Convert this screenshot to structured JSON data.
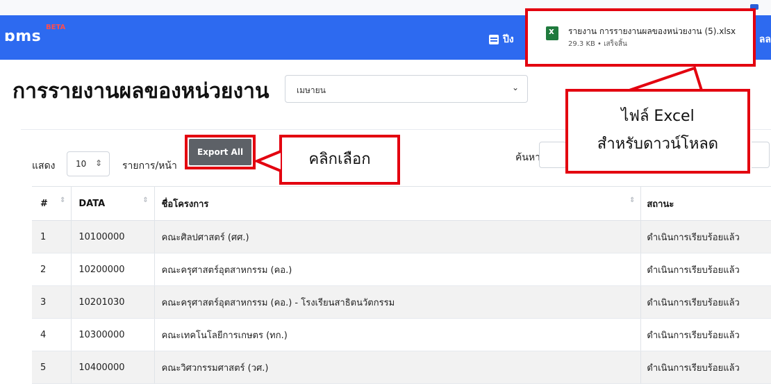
{
  "brand": {
    "name": "ɒms",
    "beta": "BETA"
  },
  "nav": {
    "calendar_label": "ปีง",
    "right_cut": "ลล"
  },
  "download": {
    "file_name": "รายงาน การรายงานผลของหน่วยงาน (5).xlsx",
    "meta": "29.3 KB • เสร็จสิ้น"
  },
  "page": {
    "title": "การรายงานผลของหน่วยงาน",
    "month": "เมษายน"
  },
  "callouts": {
    "excel_line1": "ไฟล์ Excel",
    "excel_line2": "สำหรับดาวน์โหลด",
    "click": "คลิกเลือก"
  },
  "controls": {
    "show_label": "แสดง",
    "entries_value": "10",
    "per_page_label": "รายการ/หน้า",
    "export_label": "Export All",
    "search_label": "ค้นหา :"
  },
  "table": {
    "headers": [
      "#",
      "DATA",
      "ชื่อโครงการ",
      "สถานะ"
    ],
    "rows": [
      {
        "num": "1",
        "data": "10100000",
        "name": "คณะศิลปศาสตร์ (ศศ.)",
        "status": "ดำเนินการเรียบร้อยแล้ว"
      },
      {
        "num": "2",
        "data": "10200000",
        "name": "คณะครุศาสตร์อุตสาหกรรม (คอ.)",
        "status": "ดำเนินการเรียบร้อยแล้ว"
      },
      {
        "num": "3",
        "data": "10201030",
        "name": "คณะครุศาสตร์อุตสาหกรรม (คอ.) - โรงเรียนสาธิตนวัตกรรม",
        "status": "ดำเนินการเรียบร้อยแล้ว"
      },
      {
        "num": "4",
        "data": "10300000",
        "name": "คณะเทคโนโลยีการเกษตร (ทก.)",
        "status": "ดำเนินการเรียบร้อยแล้ว"
      },
      {
        "num": "5",
        "data": "10400000",
        "name": "คณะวิศวกรรมศาสตร์ (วศ.)",
        "status": "ดำเนินการเรียบร้อยแล้ว"
      }
    ]
  },
  "colors": {
    "nav_blue": "#2d6af0",
    "annotation_red": "#e3000f",
    "status_green": "#1f9a4a",
    "export_gray": "#5d6167"
  }
}
